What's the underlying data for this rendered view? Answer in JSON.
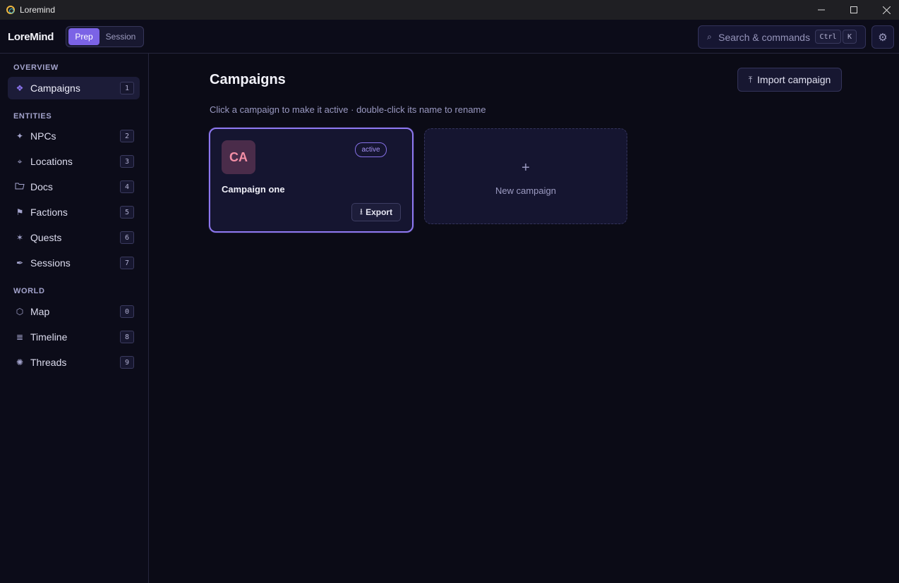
{
  "window": {
    "title": "Loremind"
  },
  "header": {
    "brand": "LoreMind",
    "modes": {
      "prep": "Prep",
      "session": "Session"
    },
    "search": {
      "label": "Search & commands",
      "shortcut_ctrl": "Ctrl",
      "shortcut_key": "K"
    }
  },
  "sidebar": {
    "overview_label": "OVERVIEW",
    "entities_label": "ENTITIES",
    "world_label": "WORLD",
    "items": [
      {
        "label": "Campaigns",
        "badge": "1",
        "icon": "diamond-icon"
      },
      {
        "label": "NPCs",
        "badge": "2",
        "icon": "sparkle-icon"
      },
      {
        "label": "Locations",
        "badge": "3",
        "icon": "pin-icon"
      },
      {
        "label": "Docs",
        "badge": "4",
        "icon": "folder-icon"
      },
      {
        "label": "Factions",
        "badge": "5",
        "icon": "flag-icon"
      },
      {
        "label": "Quests",
        "badge": "6",
        "icon": "star-icon"
      },
      {
        "label": "Sessions",
        "badge": "7",
        "icon": "quill-icon"
      },
      {
        "label": "Map",
        "badge": "0",
        "icon": "hexagon-icon"
      },
      {
        "label": "Timeline",
        "badge": "8",
        "icon": "lines-icon"
      },
      {
        "label": "Threads",
        "badge": "9",
        "icon": "asterisk-icon"
      }
    ]
  },
  "main": {
    "title": "Campaigns",
    "import_label": "Import campaign",
    "subtitle": "Click a campaign to make it active · double-click its name to rename",
    "campaigns": [
      {
        "initials": "CA",
        "name": "Campaign one",
        "badge": "active",
        "export_label": "Export"
      }
    ],
    "new_campaign": {
      "label": "New campaign"
    }
  },
  "colors": {
    "accent": "#7b63e6",
    "background": "#0b0b16",
    "card": "#151530",
    "avatar_text": "#f48fa6"
  }
}
